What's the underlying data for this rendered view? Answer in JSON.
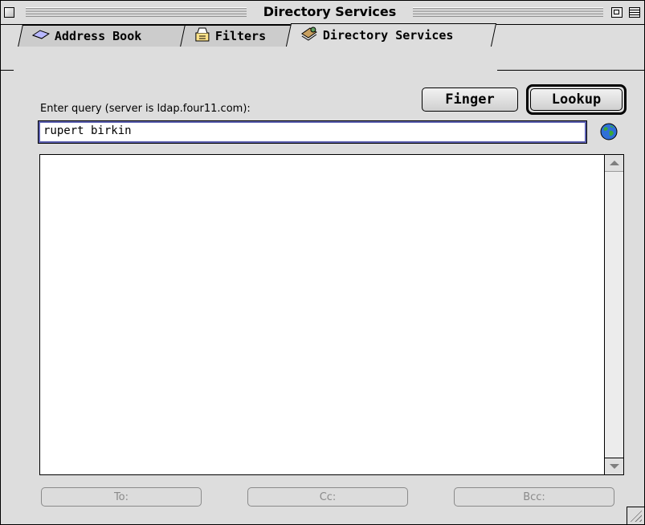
{
  "window": {
    "title": "Directory Services"
  },
  "tabs": [
    {
      "label": "Address Book",
      "icon": "address-book-icon",
      "active": false
    },
    {
      "label": "Filters",
      "icon": "filters-icon",
      "active": false
    },
    {
      "label": "Directory Services",
      "icon": "directory-services-icon",
      "active": true
    }
  ],
  "actions": {
    "finger_label": "Finger",
    "lookup_label": "Lookup"
  },
  "query": {
    "label": "Enter query (server is ldap.four11.com):",
    "value": "rupert birkin"
  },
  "results": {
    "items": []
  },
  "address_buttons": {
    "to": "To:",
    "cc": "Cc:",
    "bcc": "Bcc:"
  },
  "colors": {
    "window_bg": "#dddddd",
    "focus_ring": "#5b5fb0"
  }
}
